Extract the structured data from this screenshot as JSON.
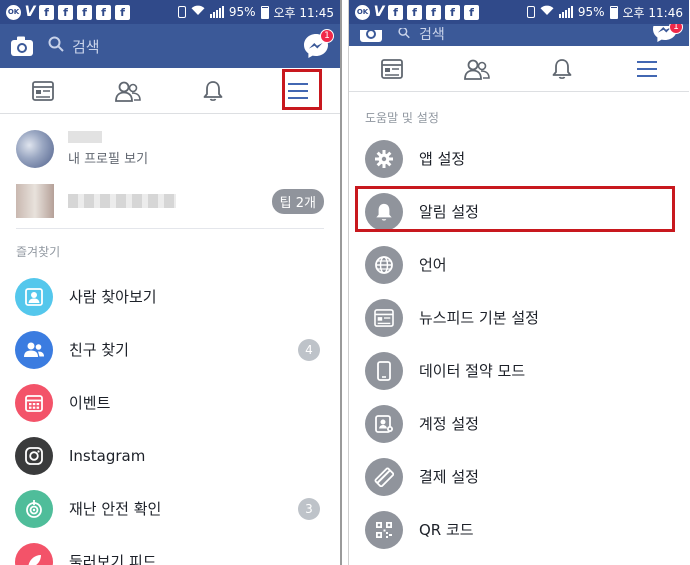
{
  "left": {
    "status": {
      "ok_text": "OK",
      "battery": "95%",
      "time": "오후 11:45"
    },
    "header": {
      "search_placeholder": "검색",
      "messenger_badge": "1"
    },
    "profile": {
      "view_label": "내 프로필 보기"
    },
    "tips": {
      "badge": "팁 2개"
    },
    "favorites_title": "즐겨찾기",
    "items": [
      {
        "label": "사람 찾아보기",
        "count": "",
        "color": "#54c7ec",
        "icon": "contact-card-icon"
      },
      {
        "label": "친구 찾기",
        "count": "4",
        "color": "#3b7ce0",
        "icon": "friends-icon"
      },
      {
        "label": "이벤트",
        "count": "",
        "color": "#f35369",
        "icon": "calendar-icon"
      },
      {
        "label": "Instagram",
        "count": "",
        "color": "#3a3b3c",
        "icon": "instagram-icon"
      },
      {
        "label": "재난 안전 확인",
        "count": "3",
        "color": "#4fbd9a",
        "icon": "safety-check-icon"
      },
      {
        "label": "둘러보기 피드",
        "count": "",
        "color": "#f35369",
        "icon": "rocket-icon"
      }
    ]
  },
  "right": {
    "status": {
      "ok_text": "OK",
      "battery": "95%",
      "time": "오후 11:46"
    },
    "header": {
      "search_placeholder": "검색",
      "messenger_badge": "1"
    },
    "section_title": "도움말 및 설정",
    "items": [
      {
        "label": "앱 설정",
        "icon": "gear-icon"
      },
      {
        "label": "알림 설정",
        "icon": "bell-icon"
      },
      {
        "label": "언어",
        "icon": "globe-icon"
      },
      {
        "label": "뉴스피드 기본 설정",
        "icon": "newsfeed-icon"
      },
      {
        "label": "데이터 절약 모드",
        "icon": "phone-icon"
      },
      {
        "label": "계정 설정",
        "icon": "account-icon"
      },
      {
        "label": "결제 설정",
        "icon": "payment-icon"
      },
      {
        "label": "QR 코드",
        "icon": "qr-code-icon"
      }
    ]
  },
  "colors": {
    "brand": "#3b5998",
    "statusbar": "#304a8a",
    "highlight": "#c8181e",
    "active_tab": "#4267b2",
    "inactive_tab": "#606770"
  }
}
